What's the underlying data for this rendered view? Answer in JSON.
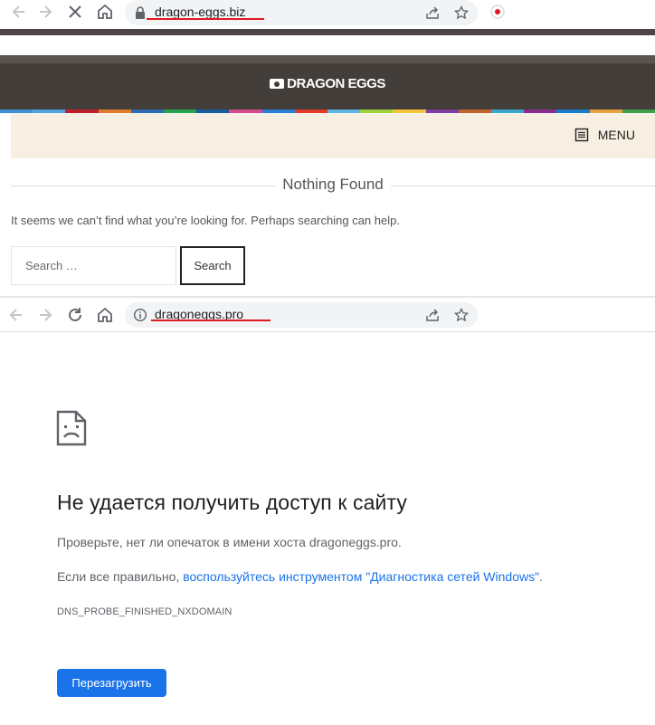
{
  "browser1": {
    "url": "dragon-eggs.biz"
  },
  "site1": {
    "logo_text": "DRAGON EGGS",
    "menu_label": "MENU",
    "heading": "Nothing Found",
    "message": "It seems we can’t find what you’re looking for. Perhaps searching can help.",
    "search_placeholder": "Search …",
    "search_button": "Search",
    "stripe_colors": [
      "#3e8fd3",
      "#4fa3e0",
      "#c21f2d",
      "#e07b2b",
      "#2e6ab5",
      "#27a44b",
      "#145c9e",
      "#d64a8b",
      "#2b7fd8",
      "#e13a26",
      "#5cb6e0",
      "#9dd039",
      "#f4c33a",
      "#7e3da0",
      "#c1632e",
      "#3aa6c9",
      "#8b2b8e",
      "#1c7ccc",
      "#e9a23b",
      "#40a04a"
    ]
  },
  "browser2": {
    "url": "dragoneggs.pro"
  },
  "error_page": {
    "title": "Не удается получить доступ к сайту",
    "line1": "Проверьте, нет ли опечаток в имени хоста dragoneggs.pro.",
    "line2_prefix": "Если все правильно, ",
    "line2_link": "воспользуйтесь инструментом \"Диагностика сетей Windows\"",
    "line2_suffix": ".",
    "error_code": "DNS_PROBE_FINISHED_NXDOMAIN",
    "reload_button": "Перезагрузить"
  },
  "colors": {
    "accent_blue": "#1a73e8",
    "header_dark": "#443e3b",
    "menu_band": "#f7efe1",
    "underline_red": "#e0191f"
  }
}
